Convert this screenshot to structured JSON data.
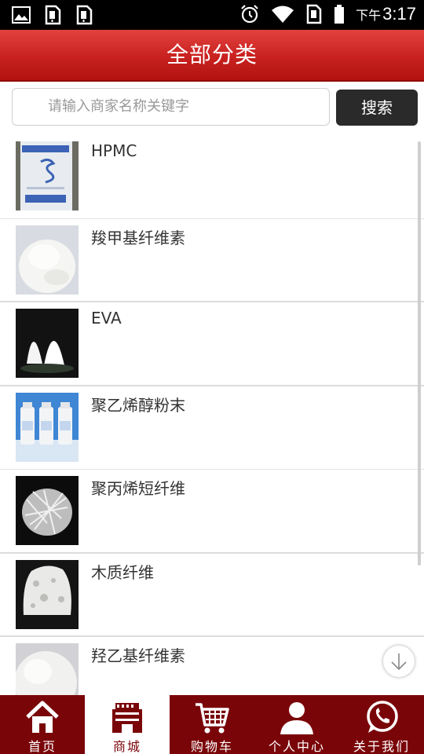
{
  "status_bar": {
    "ampm": "下午",
    "time": "3:17"
  },
  "header": {
    "title": "全部分类"
  },
  "search": {
    "placeholder": "请输入商家名称关键字",
    "button_label": "搜索"
  },
  "items": [
    {
      "title": "HPMC",
      "thumb": "hpmc-bag"
    },
    {
      "title": "羧甲基纤维素",
      "thumb": "white-powder"
    },
    {
      "title": "EVA",
      "thumb": "eva-heaps"
    },
    {
      "title": "聚乙烯醇粉末",
      "thumb": "bottles"
    },
    {
      "title": "聚丙烯短纤维",
      "thumb": "fibers-dark"
    },
    {
      "title": "木质纤维",
      "thumb": "wood-fiber"
    },
    {
      "title": "羟乙基纤维素",
      "thumb": "white-powder"
    }
  ],
  "nav": [
    {
      "label": "首页",
      "icon": "home-icon"
    },
    {
      "label": "商城",
      "icon": "shop-icon",
      "active": true
    },
    {
      "label": "购物车",
      "icon": "cart-icon"
    },
    {
      "label": "个人中心",
      "icon": "person-icon"
    },
    {
      "label": "关于我们",
      "icon": "chat-icon"
    }
  ],
  "colors": {
    "header": "#c8211f",
    "nav_bg": "#7a0509",
    "search_button": "#2a2a2a"
  }
}
